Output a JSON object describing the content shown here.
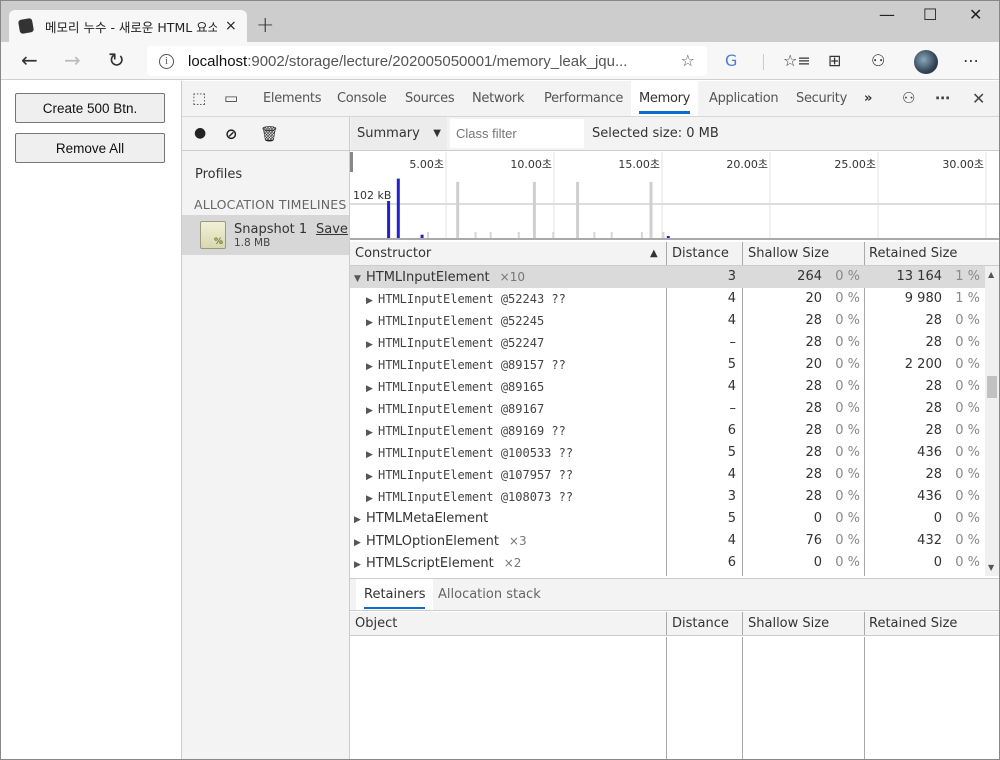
{
  "browser": {
    "tab_title": "메모리 누수 - 새로운 HTML 요소",
    "tab_close": "×",
    "new_tab": "+",
    "url_host": "localhost",
    "url_rest": ":9002/storage/lecture/202005050001/memory_leak_jqu...",
    "window_controls": {
      "minimize": "—",
      "maximize": "☐",
      "close": "✕"
    },
    "nav": {
      "back": "←",
      "forward": "→",
      "refresh": "↻"
    },
    "icons": [
      "info-icon",
      "favorite-star-icon",
      "translate-icon",
      "favorites-list-icon",
      "collections-icon",
      "feedback-icon",
      "profile-avatar",
      "more-icon"
    ]
  },
  "page": {
    "create_button": "Create 500 Btn.",
    "remove_button": "Remove All"
  },
  "devtools": {
    "tabs": [
      "Elements",
      "Console",
      "Sources",
      "Network",
      "Performance",
      "Memory",
      "Application",
      "Security"
    ],
    "active_tab": "Memory",
    "more_tabs": "»",
    "more_menu": "⋯",
    "close": "✕",
    "toolbar": {
      "view_select": "Summary",
      "class_filter_placeholder": "Class filter",
      "selected_size": "Selected size: 0 MB"
    },
    "sidebar": {
      "profiles_label": "Profiles",
      "section_label": "ALLOCATION TIMELINES",
      "snapshot": {
        "name": "Snapshot 1",
        "size": "1.8 MB",
        "save": "Save"
      }
    },
    "overview": {
      "time_ticks": [
        "5.00초",
        "10.00초",
        "15.00초",
        "20.00초",
        "25.00초",
        "30.00초"
      ],
      "y_label": "102 kB",
      "bars": [
        {
          "t": 2.55,
          "level": 0.56,
          "color": "blue"
        },
        {
          "t": 3.0,
          "level": 0.9,
          "color": "blue"
        },
        {
          "t": 4.1,
          "level": 0.05,
          "color": "blue"
        },
        {
          "t": 5.75,
          "level": 0.85,
          "color": "gray"
        },
        {
          "t": 9.3,
          "level": 0.85,
          "color": "gray"
        },
        {
          "t": 11.3,
          "level": 0.85,
          "color": "gray"
        },
        {
          "t": 14.7,
          "level": 0.85,
          "color": "gray"
        },
        {
          "t": 15.5,
          "level": 0.03,
          "color": "blue"
        }
      ]
    },
    "grid": {
      "headers": {
        "constructor": "Constructor",
        "distance": "Distance",
        "shallow": "Shallow Size",
        "retained": "Retained Size"
      },
      "rows": [
        {
          "name": "HTMLInputElement",
          "count": "×10",
          "expanded": true,
          "level": 0,
          "distance": "3",
          "shallow": "264",
          "shallow_pct": "0 %",
          "retained": "13 164",
          "retained_pct": "1 %",
          "selected": true
        },
        {
          "name": "HTMLInputElement @52243 ??",
          "level": 1,
          "distance": "4",
          "shallow": "20",
          "shallow_pct": "0 %",
          "retained": "9 980",
          "retained_pct": "1 %"
        },
        {
          "name": "HTMLInputElement @52245",
          "level": 1,
          "distance": "4",
          "shallow": "28",
          "shallow_pct": "0 %",
          "retained": "28",
          "retained_pct": "0 %"
        },
        {
          "name": "HTMLInputElement @52247",
          "level": 1,
          "distance": "–",
          "shallow": "28",
          "shallow_pct": "0 %",
          "retained": "28",
          "retained_pct": "0 %"
        },
        {
          "name": "HTMLInputElement @89157 ??",
          "level": 1,
          "distance": "5",
          "shallow": "20",
          "shallow_pct": "0 %",
          "retained": "2 200",
          "retained_pct": "0 %"
        },
        {
          "name": "HTMLInputElement @89165",
          "level": 1,
          "distance": "4",
          "shallow": "28",
          "shallow_pct": "0 %",
          "retained": "28",
          "retained_pct": "0 %"
        },
        {
          "name": "HTMLInputElement @89167",
          "level": 1,
          "distance": "–",
          "shallow": "28",
          "shallow_pct": "0 %",
          "retained": "28",
          "retained_pct": "0 %"
        },
        {
          "name": "HTMLInputElement @89169 ??",
          "level": 1,
          "distance": "6",
          "shallow": "28",
          "shallow_pct": "0 %",
          "retained": "28",
          "retained_pct": "0 %"
        },
        {
          "name": "HTMLInputElement @100533 ??",
          "level": 1,
          "distance": "5",
          "shallow": "28",
          "shallow_pct": "0 %",
          "retained": "436",
          "retained_pct": "0 %"
        },
        {
          "name": "HTMLInputElement @107957 ??",
          "level": 1,
          "distance": "4",
          "shallow": "28",
          "shallow_pct": "0 %",
          "retained": "28",
          "retained_pct": "0 %"
        },
        {
          "name": "HTMLInputElement @108073 ??",
          "level": 1,
          "distance": "3",
          "shallow": "28",
          "shallow_pct": "0 %",
          "retained": "436",
          "retained_pct": "0 %"
        },
        {
          "name": "HTMLMetaElement",
          "count": "",
          "level": 0,
          "distance": "5",
          "shallow": "0",
          "shallow_pct": "0 %",
          "retained": "0",
          "retained_pct": "0 %"
        },
        {
          "name": "HTMLOptionElement",
          "count": "×3",
          "level": 0,
          "distance": "4",
          "shallow": "76",
          "shallow_pct": "0 %",
          "retained": "432",
          "retained_pct": "0 %"
        },
        {
          "name": "HTMLScriptElement",
          "count": "×2",
          "level": 0,
          "distance": "6",
          "shallow": "0",
          "shallow_pct": "0 %",
          "retained": "0",
          "retained_pct": "0 %"
        }
      ]
    },
    "bottom": {
      "tabs": [
        "Retainers",
        "Allocation stack"
      ],
      "active_tab": "Retainers",
      "headers": {
        "object": "Object",
        "distance": "Distance",
        "shallow": "Shallow Size",
        "retained": "Retained Size"
      }
    }
  }
}
